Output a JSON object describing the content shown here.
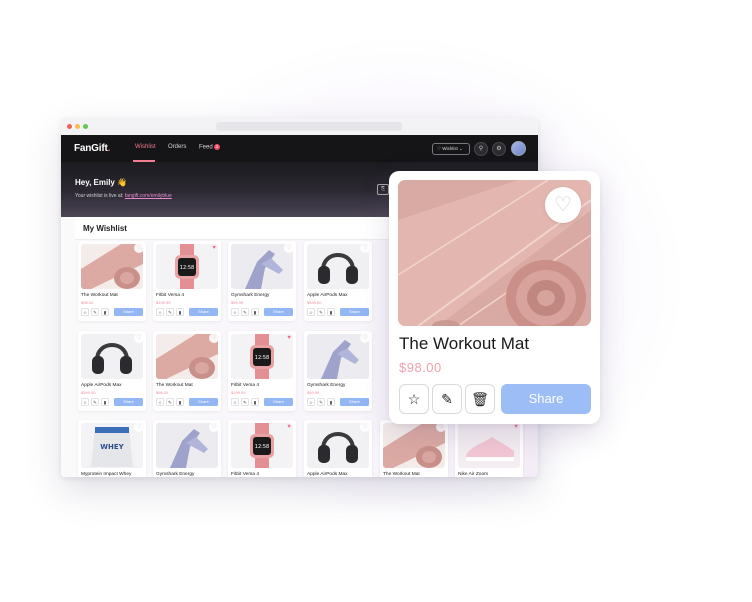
{
  "colors": {
    "accent": "#f07d90",
    "share_blue": "#93b6f5",
    "price_pink": "#ee8fa0",
    "nav_bg": "#151417"
  },
  "app": {
    "logo_main": "FanGift",
    "logo_dot": "."
  },
  "nav": {
    "wishlist": "Wishlist",
    "orders": "Orders",
    "feed": "Feed",
    "feed_badge": "3",
    "wishlist_select": "♡ Wishlist ⌄"
  },
  "hero": {
    "greeting": "Hey, Emily 👋",
    "live_prefix": "Your wishlist is live at:",
    "live_link": "fangift.com/emilyblue"
  },
  "wishlist": {
    "title": "My Wishlist"
  },
  "actions": {
    "share": "Share"
  },
  "cards": [
    {
      "name": "The Workout Mat",
      "price": "$98.00",
      "img": "mat",
      "liked": false
    },
    {
      "name": "Fitbit Versa 4",
      "price": "$199.95",
      "img": "watch",
      "liked": true
    },
    {
      "name": "Gymshark Energy",
      "price": "$59.99",
      "img": "legs",
      "liked": false
    },
    {
      "name": "Apple AirPods Max",
      "price": "$549.00",
      "img": "headphones",
      "liked": false
    },
    {
      "name": "Apple AirPods Max",
      "price": "$549.00",
      "img": "headphones",
      "liked": false
    },
    {
      "name": "The Workout Mat",
      "price": "$98.00",
      "img": "mat",
      "liked": false
    },
    {
      "name": "Fitbit Versa 4",
      "price": "$199.95",
      "img": "watch",
      "liked": true
    },
    {
      "name": "Gymshark Energy",
      "price": "$59.99",
      "img": "legs",
      "liked": false
    },
    {
      "name": "Myprotein Impact Whey",
      "price": "",
      "img": "protein",
      "liked": false
    },
    {
      "name": "Gymshark Energy",
      "price": "",
      "img": "legs",
      "liked": false
    },
    {
      "name": "Fitbit Versa 4",
      "price": "",
      "img": "watch",
      "liked": true
    },
    {
      "name": "Apple AirPods Max",
      "price": "",
      "img": "headphones",
      "liked": false
    },
    {
      "name": "The Workout Mat",
      "price": "",
      "img": "mat",
      "liked": false
    },
    {
      "name": "Nike Air Zoom",
      "price": "",
      "img": "shoe",
      "liked": true
    }
  ],
  "popup": {
    "name": "The Workout Mat",
    "price": "$98.00",
    "share_label": "Share"
  }
}
